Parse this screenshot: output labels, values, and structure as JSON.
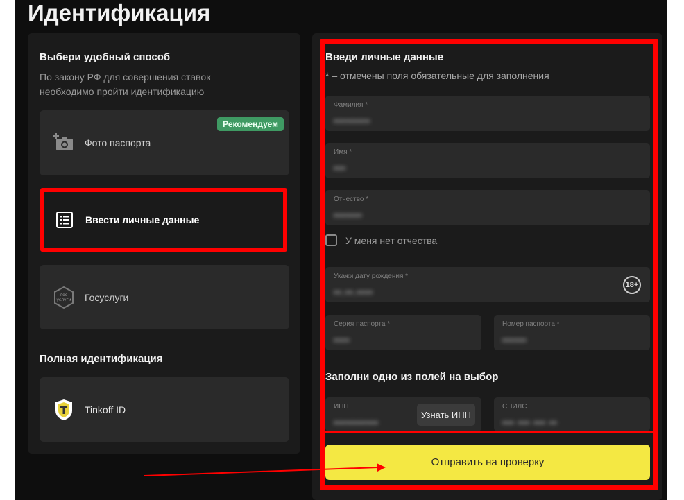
{
  "title": "Идентификация",
  "left": {
    "heading": "Выбери удобный способ",
    "subtext": "По закону РФ для совершения ставок необходимо пройти идентификацию",
    "options": [
      {
        "label": "Фото паспорта",
        "icon": "add-photo-icon",
        "badge": "Рекомендуем"
      },
      {
        "label": "Ввести личные данные",
        "icon": "list-form-icon"
      },
      {
        "label": "Госуслуги",
        "icon": "gosuslugi-icon"
      }
    ],
    "full_heading": "Полная идентификация",
    "full_options": [
      {
        "label": "Tinkoff ID",
        "icon": "tinkoff-icon"
      }
    ]
  },
  "right": {
    "heading": "Введи личные данные",
    "note": "* – отмечены поля обязательные для заполнения",
    "fields": {
      "surname": {
        "label": "Фамилия *",
        "value": "•••••••••"
      },
      "name": {
        "label": "Имя *",
        "value": "•••"
      },
      "patronymic": {
        "label": "Отчество *",
        "value": "•••••••"
      },
      "birthdate": {
        "label": "Укажи дату рождения *",
        "value": "••.••.••••"
      },
      "passport_series": {
        "label": "Серия паспорта *",
        "value": "••••"
      },
      "passport_number": {
        "label": "Номер паспорта *",
        "value": "••••••"
      },
      "inn": {
        "label": "ИНН",
        "value": "•••••••••••"
      },
      "snils": {
        "label": "СНИЛС",
        "value": "••• ••• ••• ••"
      }
    },
    "no_patronymic_label": "У меня нет отчества",
    "age_badge": "18+",
    "choice_heading": "Заполни одно из полей на выбор",
    "inn_button": "Узнать ИНН",
    "submit": "Отправить на проверку"
  },
  "colors": {
    "highlight": "#ff0000",
    "submit": "#f4e843",
    "badge": "#3f9a63"
  }
}
